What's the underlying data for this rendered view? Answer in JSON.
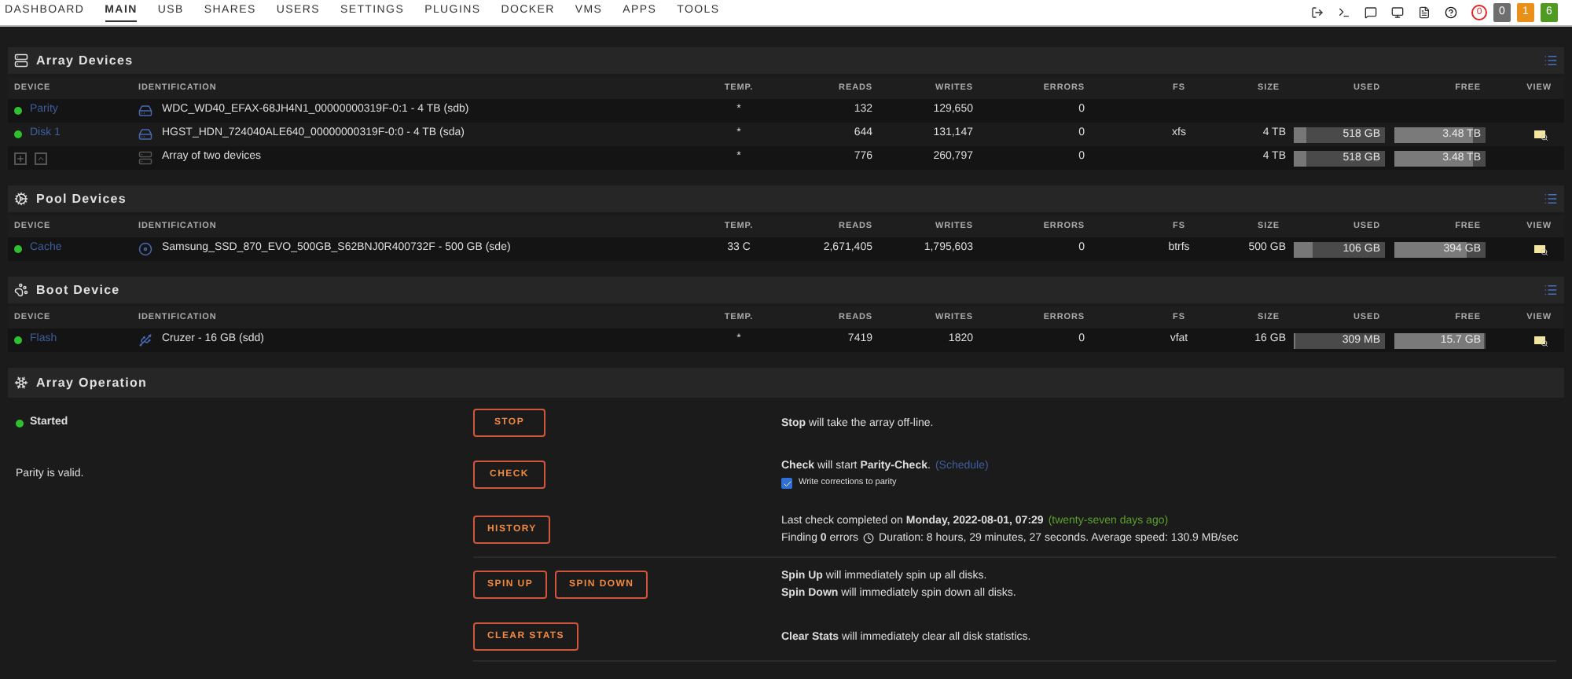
{
  "nav": {
    "items": [
      {
        "label": "DASHBOARD",
        "selected": false
      },
      {
        "label": "MAIN",
        "selected": true
      },
      {
        "label": "USB",
        "selected": false
      },
      {
        "label": "SHARES",
        "selected": false
      },
      {
        "label": "USERS",
        "selected": false
      },
      {
        "label": "SETTINGS",
        "selected": false
      },
      {
        "label": "PLUGINS",
        "selected": false
      },
      {
        "label": "DOCKER",
        "selected": false
      },
      {
        "label": "VMS",
        "selected": false
      },
      {
        "label": "APPS",
        "selected": false
      },
      {
        "label": "TOOLS",
        "selected": false
      }
    ],
    "badges": [
      {
        "label": "0",
        "kind": "ring",
        "color": "#e02424"
      },
      {
        "label": "0",
        "kind": "box",
        "color": "#6e6e6e"
      },
      {
        "label": "1",
        "kind": "box",
        "color": "#e8901a"
      },
      {
        "label": "6",
        "kind": "box",
        "color": "#4f9a22"
      }
    ]
  },
  "sections": [
    {
      "title": "Array Devices",
      "kind": "array",
      "columns": [
        "DEVICE",
        "IDENTIFICATION",
        "TEMP.",
        "READS",
        "WRITES",
        "ERRORS",
        "FS",
        "SIZE",
        "USED",
        "FREE",
        "VIEW"
      ],
      "rows": [
        {
          "kind": "disk",
          "device": "Parity",
          "identification": "WDC_WD40_EFAX-68JH4N1_00000000319F-0:1 - 4 TB (sdb)",
          "temp": "*",
          "reads": "132",
          "writes": "129,650",
          "errors": "0",
          "view": false
        },
        {
          "kind": "disk",
          "device": "Disk 1",
          "identification": "HGST_HDN_724040ALE640_00000000319F-0:0 - 4 TB (sda)",
          "temp": "*",
          "reads": "644",
          "writes": "131,147",
          "errors": "0",
          "fs": "xfs",
          "size": "4 TB",
          "used": {
            "text": "518 GB",
            "level": 0.13
          },
          "free": {
            "text": "3.48 TB",
            "level": 0.87
          },
          "view": true
        },
        {
          "kind": "summary",
          "identification": "Array of two devices",
          "temp": "*",
          "reads": "776",
          "writes": "260,797",
          "errors": "0",
          "size": "4 TB",
          "used": {
            "text": "518 GB",
            "level": 0.13
          },
          "free": {
            "text": "3.48 TB",
            "level": 0.87
          },
          "view": false
        }
      ]
    },
    {
      "title": "Pool Devices",
      "kind": "pool",
      "columns": [
        "DEVICE",
        "IDENTIFICATION",
        "TEMP.",
        "READS",
        "WRITES",
        "ERRORS",
        "FS",
        "SIZE",
        "USED",
        "FREE",
        "VIEW"
      ],
      "rows": [
        {
          "kind": "ssd",
          "device": "Cache",
          "identification": "Samsung_SSD_870_EVO_500GB_S62BNJ0R400732F - 500 GB (sde)",
          "temp": "33 C",
          "reads": "2,671,405",
          "writes": "1,795,603",
          "errors": "0",
          "fs": "btrfs",
          "size": "500 GB",
          "used": {
            "text": "106 GB",
            "level": 0.21
          },
          "free": {
            "text": "394 GB",
            "level": 0.79
          },
          "view": true
        }
      ]
    },
    {
      "title": "Boot Device",
      "kind": "boot",
      "columns": [
        "DEVICE",
        "IDENTIFICATION",
        "TEMP.",
        "READS",
        "WRITES",
        "ERRORS",
        "FS",
        "SIZE",
        "USED",
        "FREE",
        "VIEW"
      ],
      "rows": [
        {
          "kind": "flash",
          "device": "Flash",
          "identification": "Cruzer - 16 GB (sdd)",
          "temp": "*",
          "reads": "7419",
          "writes": "1820",
          "errors": "0",
          "fs": "vfat",
          "size": "16 GB",
          "used": {
            "text": "309 MB",
            "level": 0.02
          },
          "free": {
            "text": "15.7 GB",
            "level": 0.98
          },
          "view": true
        }
      ]
    }
  ],
  "operation": {
    "title": "Array Operation",
    "rows": [
      {
        "status": "Started",
        "buttons": [
          "STOP"
        ],
        "lines": [
          "**Stop** will take the array off-line."
        ],
        "divider": false
      },
      {
        "note": "Parity is valid.",
        "buttons": [
          "CHECK"
        ],
        "lines": [
          "**Check** will start **Parity-Check**."
        ],
        "link": "(Schedule)",
        "checkbox": {
          "label": "Write corrections to parity",
          "checked": true
        },
        "divider": false
      },
      {
        "buttons": [
          "HISTORY"
        ],
        "lines": [
          "Last check completed on **Monday, 2022-08-01, 07:29**"
        ],
        "ago": "(twenty-seven days ago)",
        "finding": "Finding **0** errors",
        "duration": "Duration: 8 hours, 29 minutes, 27 seconds. Average speed: 130.9 MB/sec",
        "divider": true
      },
      {
        "buttons": [
          "SPIN UP",
          "SPIN DOWN"
        ],
        "lines": [
          "**Spin Up** will immediately spin up all disks.",
          "**Spin Down** will immediately spin down all disks."
        ],
        "divider": false
      },
      {
        "buttons": [
          "CLEAR STATS"
        ],
        "lines": [
          "**Clear Stats** will immediately clear all disk statistics."
        ],
        "divider": true
      }
    ]
  }
}
